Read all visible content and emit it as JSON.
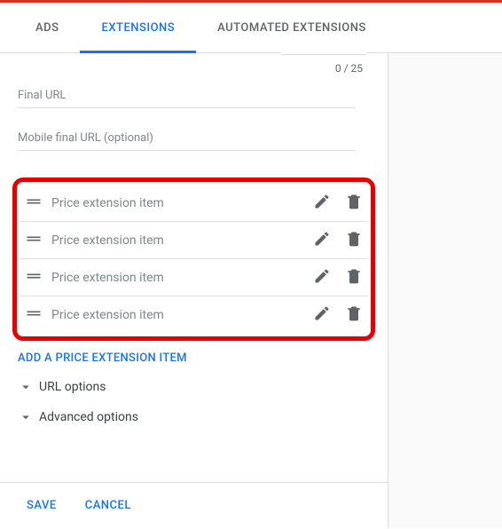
{
  "tabs": {
    "ads": "ADS",
    "extensions": "EXTENSIONS",
    "automated": "AUTOMATED EXTENSIONS"
  },
  "char_counter": "0 / 25",
  "fields": {
    "final_url": "Final URL",
    "mobile_final_url": "Mobile final URL (optional)"
  },
  "items": [
    {
      "label": "Price extension item"
    },
    {
      "label": "Price extension item"
    },
    {
      "label": "Price extension item"
    },
    {
      "label": "Price extension item"
    }
  ],
  "add_item": "ADD A PRICE EXTENSION ITEM",
  "expanders": {
    "url_options": "URL options",
    "advanced": "Advanced options"
  },
  "buttons": {
    "save": "SAVE",
    "cancel": "CANCEL"
  }
}
